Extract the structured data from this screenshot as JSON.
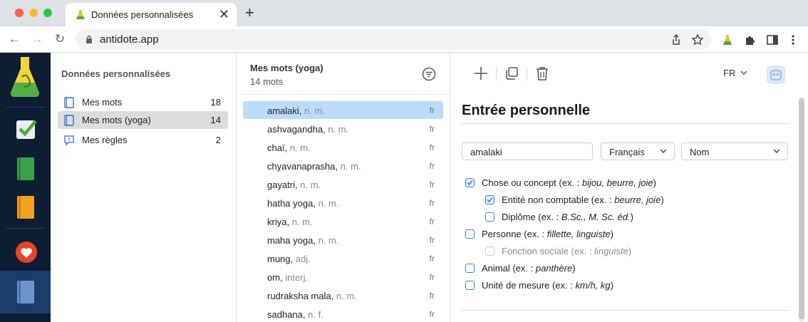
{
  "browser": {
    "tab_title": "Données personnalisées",
    "tab_close": "✕",
    "new_tab": "+",
    "url": "antidote.app",
    "nav": {
      "back": "←",
      "forward": "→",
      "reload": "↻"
    }
  },
  "sidebar": {
    "title": "Données personnalisées",
    "items": [
      {
        "label": "Mes mots",
        "count": "18",
        "icon": "book-icon"
      },
      {
        "label": "Mes mots (yoga)",
        "count": "14",
        "icon": "book-icon"
      },
      {
        "label": "Mes règles",
        "count": "2",
        "icon": "rule-icon"
      }
    ]
  },
  "wordlist": {
    "title": "Mes mots (yoga)",
    "subtitle": "14 mots",
    "items": [
      {
        "term": "amalaki",
        "pos": "n. m.",
        "lang": "fr"
      },
      {
        "term": "ashvagandha",
        "pos": "n. m.",
        "lang": "fr"
      },
      {
        "term": "chaï",
        "pos": "n. m.",
        "lang": "fr"
      },
      {
        "term": "chyavanaprasha",
        "pos": "n. m.",
        "lang": "fr"
      },
      {
        "term": "gayatri",
        "pos": "n. m.",
        "lang": "fr"
      },
      {
        "term": "hatha yoga",
        "pos": "n. m.",
        "lang": "fr"
      },
      {
        "term": "kriya",
        "pos": "n. m.",
        "lang": "fr"
      },
      {
        "term": "maha yoga",
        "pos": "n. m.",
        "lang": "fr"
      },
      {
        "term": "mung",
        "pos": "adj.",
        "lang": "fr"
      },
      {
        "term": "om",
        "pos": "interj.",
        "lang": "fr"
      },
      {
        "term": "rudraksha mala",
        "pos": "n. m.",
        "lang": "fr"
      },
      {
        "term": "sadhana",
        "pos": "n. f.",
        "lang": "fr"
      }
    ]
  },
  "editor": {
    "language_code": "FR",
    "heading": "Entrée personnelle",
    "word_value": "amalaki",
    "language_value": "Français",
    "category_value": "Nom",
    "options": [
      {
        "label": "Chose ou concept (ex. : ",
        "ex": "bijou, beurre, joie",
        "close": ")",
        "checked": true,
        "indent": false,
        "disabled": false
      },
      {
        "label": "Entité non comptable (ex. : ",
        "ex": "beurre, joie",
        "close": ")",
        "checked": true,
        "indent": true,
        "disabled": false
      },
      {
        "label": "Diplôme (ex. : ",
        "ex": "B.Sc., M. Sc. éd.",
        "close": ")",
        "checked": false,
        "indent": true,
        "disabled": false
      },
      {
        "label": "Personne (ex. : ",
        "ex": "fillette, linguiste",
        "close": ")",
        "checked": false,
        "indent": false,
        "disabled": false
      },
      {
        "label": "Fonction sociale (ex. : ",
        "ex": "linguiste",
        "close": ")",
        "checked": false,
        "indent": true,
        "disabled": true
      },
      {
        "label": "Animal (ex. : ",
        "ex": "panthère",
        "close": ")",
        "checked": false,
        "indent": false,
        "disabled": false
      },
      {
        "label": "Unité de mesure (ex. : ",
        "ex": "km/h, kg",
        "close": ")",
        "checked": false,
        "indent": false,
        "disabled": false
      }
    ]
  },
  "colors": {
    "rail_bg": "#0d1d33",
    "selected_word_bg": "#bcdcfd",
    "selected_list_bg": "#dcdcdc",
    "checkbox_accent": "#3b82d6"
  }
}
